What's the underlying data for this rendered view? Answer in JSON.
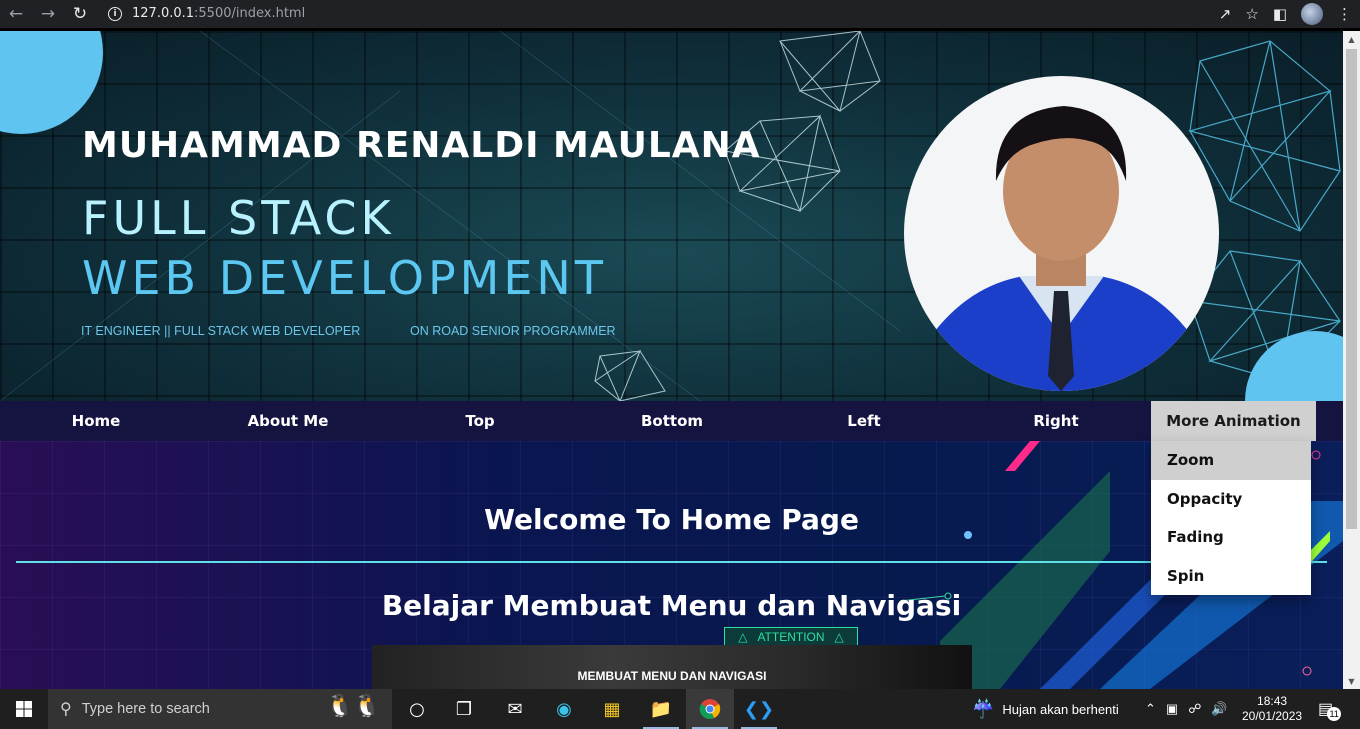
{
  "browser": {
    "url_host": "127.0.0.1",
    "url_path": ":5500/index.html"
  },
  "hero": {
    "name": "MUHAMMAD RENALDI MAULANA",
    "line1": "FULL STACK",
    "line2": "WEB DEVELOPMENT",
    "tagline1": "IT ENGINEER || FULL STACK WEB DEVELOPER",
    "tagline2": "ON ROAD SENIOR PROGRAMMER"
  },
  "nav": {
    "items": [
      {
        "label": "Home"
      },
      {
        "label": "About Me"
      },
      {
        "label": "Top"
      },
      {
        "label": "Bottom"
      },
      {
        "label": "Left"
      },
      {
        "label": "Right"
      },
      {
        "label": "More Animation"
      }
    ],
    "dropdown": [
      {
        "label": "Zoom"
      },
      {
        "label": "Oppacity"
      },
      {
        "label": "Fading"
      },
      {
        "label": "Spin"
      }
    ]
  },
  "content": {
    "welcome": "Welcome To Home Page",
    "subtitle": "Belajar Membuat Menu dan Navigasi",
    "attention": "ATTENTION",
    "video_caption": "MEMBUAT MENU DAN NAVIGASI"
  },
  "taskbar": {
    "search_placeholder": "Type here to search",
    "weather": "Hujan akan berhenti",
    "time": "18:43",
    "date": "20/01/2023",
    "notification_count": "11"
  },
  "colors": {
    "accent_cyan": "#5cc8f2",
    "nav_bg": "#15133f",
    "divider": "#5fe0e6"
  }
}
